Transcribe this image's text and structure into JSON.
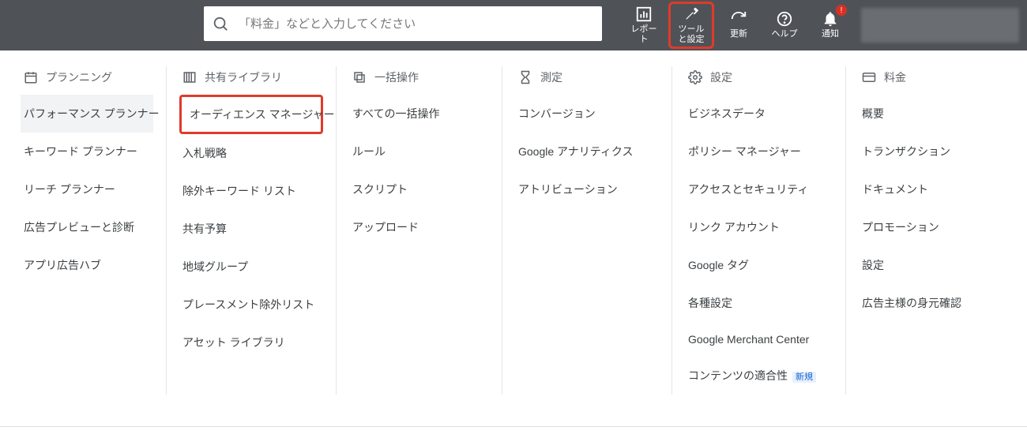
{
  "search": {
    "placeholder": "「料金」などと入力してください"
  },
  "topbar": {
    "report": "レポート",
    "tools": "ツールと設定",
    "refresh": "更新",
    "help": "ヘルプ",
    "notifications": "通知",
    "notif_badge": "!"
  },
  "columns": [
    {
      "header": "プランニング",
      "items": [
        {
          "label": "パフォーマンス プランナー",
          "active": true
        },
        {
          "label": "キーワード プランナー"
        },
        {
          "label": "リーチ プランナー"
        },
        {
          "label": "広告プレビューと診断"
        },
        {
          "label": "アプリ広告ハブ"
        }
      ]
    },
    {
      "header": "共有ライブラリ",
      "items": [
        {
          "label": "オーディエンス マネージャー",
          "highlighted": true
        },
        {
          "label": "入札戦略"
        },
        {
          "label": "除外キーワード リスト"
        },
        {
          "label": "共有予算"
        },
        {
          "label": "地域グループ"
        },
        {
          "label": "プレースメント除外リスト"
        },
        {
          "label": "アセット ライブラリ"
        }
      ]
    },
    {
      "header": "一括操作",
      "items": [
        {
          "label": "すべての一括操作"
        },
        {
          "label": "ルール"
        },
        {
          "label": "スクリプト"
        },
        {
          "label": "アップロード"
        }
      ]
    },
    {
      "header": "測定",
      "items": [
        {
          "label": "コンバージョン"
        },
        {
          "label": "Google アナリティクス"
        },
        {
          "label": "アトリビューション"
        }
      ]
    },
    {
      "header": "設定",
      "items": [
        {
          "label": "ビジネスデータ"
        },
        {
          "label": "ポリシー マネージャー"
        },
        {
          "label": "アクセスとセキュリティ"
        },
        {
          "label": "リンク アカウント"
        },
        {
          "label": "Google タグ"
        },
        {
          "label": "各種設定"
        },
        {
          "label": "Google Merchant Center"
        },
        {
          "label": "コンテンツの適合性",
          "badge": "新規"
        }
      ]
    },
    {
      "header": "料金",
      "items": [
        {
          "label": "概要"
        },
        {
          "label": "トランザクション"
        },
        {
          "label": "ドキュメント"
        },
        {
          "label": "プロモーション"
        },
        {
          "label": "設定"
        },
        {
          "label": "広告主様の身元確認"
        }
      ]
    }
  ],
  "icons": {
    "calendar": "calendar-icon",
    "library": "library-icon",
    "bulk": "bulk-icon",
    "measure": "hourglass-icon",
    "settings": "gear-icon",
    "billing": "card-icon"
  }
}
